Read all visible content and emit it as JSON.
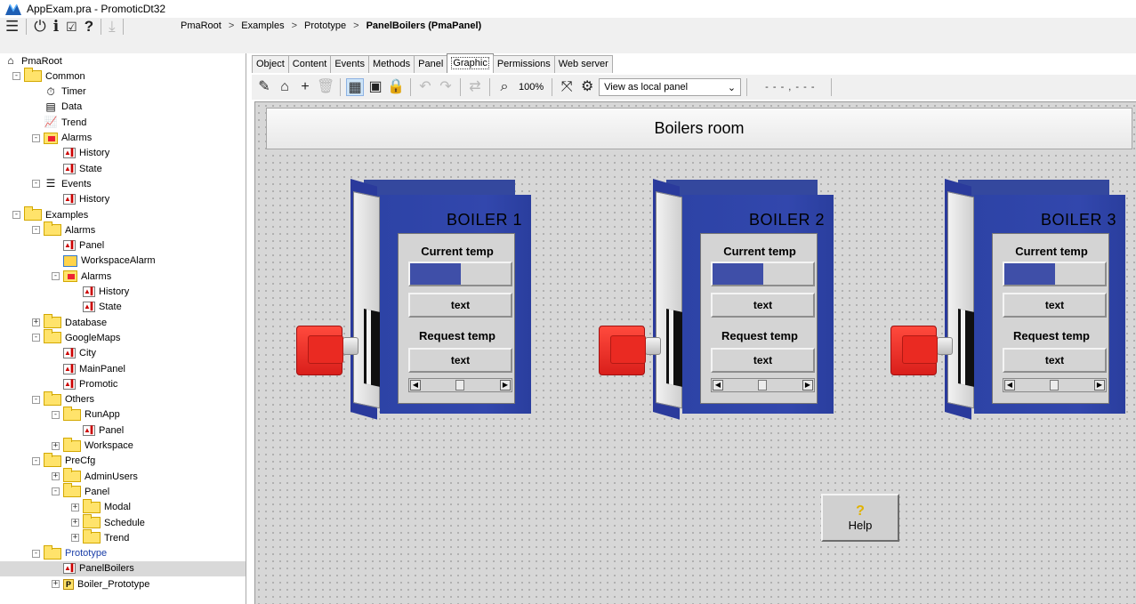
{
  "window": {
    "title": "AppExam.pra - PromoticDt32"
  },
  "main_toolbar": {
    "icons": [
      "menu-icon",
      "power-icon",
      "info-icon",
      "check-icon",
      "help-icon",
      "download-icon"
    ]
  },
  "breadcrumb": {
    "items": [
      "PmaRoot",
      "Examples",
      "Prototype"
    ],
    "current": "PanelBoilers (PmaPanel)",
    "separator": ">"
  },
  "tree": {
    "items": [
      {
        "label": "PmaRoot",
        "icon": "home-icon"
      },
      {
        "label": "Common",
        "icon": "folder-icon"
      },
      {
        "label": "Timer",
        "icon": "timer-icon"
      },
      {
        "label": "Data",
        "icon": "data-icon"
      },
      {
        "label": "Trend",
        "icon": "trend-icon"
      },
      {
        "label": "Alarms",
        "icon": "alarms-icon"
      },
      {
        "label": "History",
        "icon": "panel-icon"
      },
      {
        "label": "State",
        "icon": "panel-icon"
      },
      {
        "label": "Events",
        "icon": "events-icon"
      },
      {
        "label": "History",
        "icon": "panel-icon"
      },
      {
        "label": "Examples",
        "icon": "folder-icon"
      },
      {
        "label": "Alarms",
        "icon": "folder-icon"
      },
      {
        "label": "Panel",
        "icon": "panel-icon"
      },
      {
        "label": "WorkspaceAlarm",
        "icon": "workspace-icon"
      },
      {
        "label": "Alarms",
        "icon": "alarms-icon"
      },
      {
        "label": "History",
        "icon": "panel-icon"
      },
      {
        "label": "State",
        "icon": "panel-icon"
      },
      {
        "label": "Database",
        "icon": "folder-icon"
      },
      {
        "label": "GoogleMaps",
        "icon": "folder-icon"
      },
      {
        "label": "City",
        "icon": "panel-icon"
      },
      {
        "label": "MainPanel",
        "icon": "panel-icon"
      },
      {
        "label": "Promotic",
        "icon": "panel-icon"
      },
      {
        "label": "Others",
        "icon": "folder-icon"
      },
      {
        "label": "RunApp",
        "icon": "folder-icon"
      },
      {
        "label": "Panel",
        "icon": "panel-icon"
      },
      {
        "label": "Workspace",
        "icon": "folder-icon"
      },
      {
        "label": "PreCfg",
        "icon": "folder-icon"
      },
      {
        "label": "AdminUsers",
        "icon": "folder-icon"
      },
      {
        "label": "Panel",
        "icon": "folder-icon"
      },
      {
        "label": "Modal",
        "icon": "folder-icon"
      },
      {
        "label": "Schedule",
        "icon": "folder-icon"
      },
      {
        "label": "Trend",
        "icon": "folder-icon"
      },
      {
        "label": "Prototype",
        "icon": "folder-icon"
      },
      {
        "label": "PanelBoilers",
        "icon": "panel-icon"
      },
      {
        "label": "Boiler_Prototype",
        "icon": "prototype-icon"
      }
    ]
  },
  "tabs": [
    "Object",
    "Content",
    "Events",
    "Methods",
    "Panel",
    "Graphic",
    "Permissions",
    "Web server"
  ],
  "active_tab": "Graphic",
  "graphic_toolbar": {
    "zoom": "100%",
    "view_select": "View as local panel",
    "coords": "- - - , - - -"
  },
  "canvas": {
    "header": "Boilers room",
    "boilers": [
      {
        "title": "BOILER 1",
        "current_label": "Current temp",
        "current_text": "text",
        "request_label": "Request temp",
        "request_text": "text",
        "level": 0.5
      },
      {
        "title": "BOILER 2",
        "current_label": "Current temp",
        "current_text": "text",
        "request_label": "Request temp",
        "request_text": "text",
        "level": 0.5
      },
      {
        "title": "BOILER 3",
        "current_label": "Current temp",
        "current_text": "text",
        "request_label": "Request temp",
        "request_text": "text",
        "level": 0.5
      }
    ],
    "help_button": "Help"
  },
  "colors": {
    "boiler_blue": "#3247ad",
    "burner_red": "#e3281f",
    "canvas_bg": "#d7d7d7"
  }
}
